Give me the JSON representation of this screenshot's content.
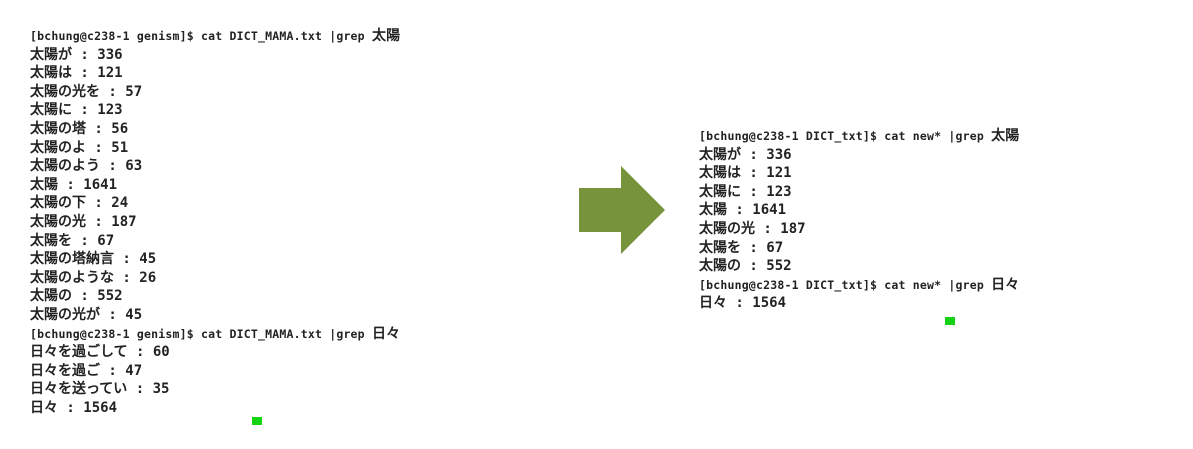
{
  "before": {
    "prompt1": "[bchung@c238-1 genism]$ cat DICT_MAMA.txt |grep ",
    "query1": "太陽",
    "results1": [
      "太陽が : 336",
      "太陽は : 121",
      "太陽の光を : 57",
      "太陽に : 123",
      "太陽の塔 : 56",
      "太陽のよ : 51",
      "太陽のよう : 63",
      "太陽 : 1641",
      "太陽の下 : 24",
      "太陽の光 : 187",
      "太陽を : 67",
      "太陽の塔納言 : 45",
      "太陽のような : 26",
      "太陽の : 552",
      "太陽の光が : 45"
    ],
    "prompt2": "[bchung@c238-1 genism]$ cat DICT_MAMA.txt |grep ",
    "query2": "日々",
    "results2": [
      "日々を過ごして : 60",
      "日々を過ご : 47",
      "日々を送ってい : 35",
      "日々 : 1564"
    ]
  },
  "after": {
    "prompt1": "[bchung@c238-1 DICT_txt]$ cat new* |grep ",
    "query1": "太陽",
    "results1": [
      "太陽が : 336",
      "太陽は : 121",
      "太陽に : 123",
      "太陽 : 1641",
      "太陽の光 : 187",
      "太陽を : 67",
      "太陽の : 552"
    ],
    "prompt2": "[bchung@c238-1 DICT_txt]$ cat new* |grep ",
    "query2": "日々",
    "results2": [
      "日々 : 1564"
    ]
  },
  "colors": {
    "arrow": "#77933c",
    "cursor": "#13d313",
    "text": "#222222"
  },
  "icons": {
    "transition": "right-arrow-icon",
    "cursor": "terminal-cursor"
  }
}
